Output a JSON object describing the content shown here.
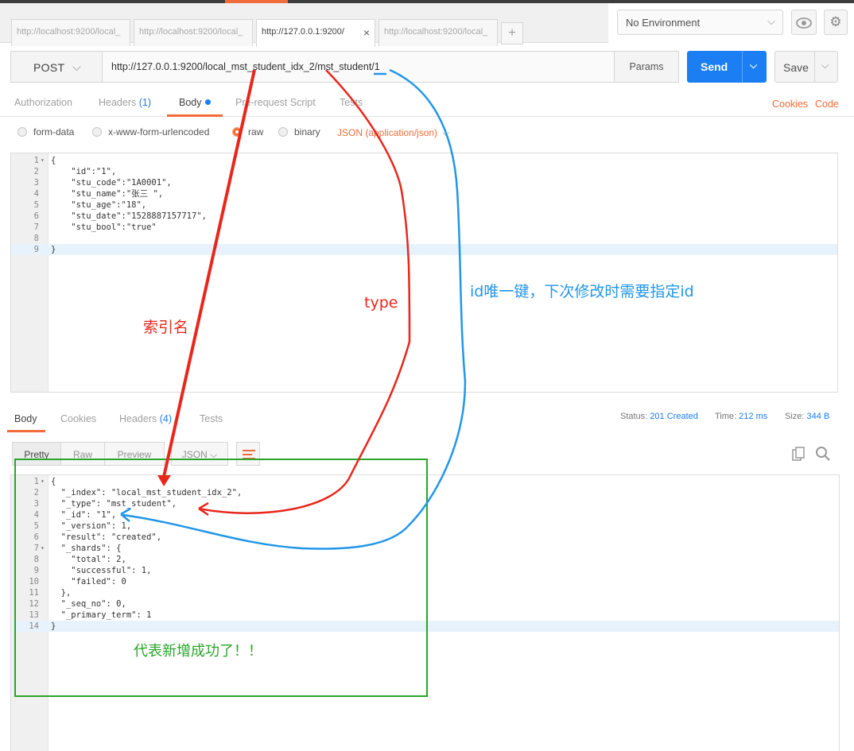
{
  "tabs": [
    {
      "label": "http://localhost:9200/local_"
    },
    {
      "label": "http://localhost:9200/local_"
    },
    {
      "label": "http://127.0.0.1:9200/"
    },
    {
      "label": "http://localhost:9200/local_"
    }
  ],
  "add_tab": "+",
  "close_tab": "×",
  "environment": {
    "selected": "No Environment"
  },
  "request": {
    "method": "POST",
    "url": "http://127.0.0.1:9200/local_mst_student_idx_2/mst_student/1",
    "params_label": "Params",
    "send_label": "Send",
    "save_label": "Save"
  },
  "request_tabs": {
    "authorization": "Authorization",
    "headers": "Headers",
    "headers_count": "(1)",
    "body": "Body",
    "prerequest": "Pre-request Script",
    "tests": "Tests",
    "cookies": "Cookies",
    "code": "Code"
  },
  "body_modes": {
    "form_data": "form-data",
    "urlencoded": "x-www-form-urlencoded",
    "raw": "raw",
    "binary": "binary",
    "content_type": "JSON (application/json)"
  },
  "request_body": [
    {
      "n": "1",
      "fold": true,
      "t": "{"
    },
    {
      "n": "2",
      "t": "    \"id\":\"1\","
    },
    {
      "n": "3",
      "t": "    \"stu_code\":\"1A0001\","
    },
    {
      "n": "4",
      "t": "    \"stu_name\":\"张三 \","
    },
    {
      "n": "5",
      "t": "    \"stu_age\":\"18\","
    },
    {
      "n": "6",
      "t": "    \"stu_date\":\"1528887157717\","
    },
    {
      "n": "7",
      "t": "    \"stu_bool\":\"true\""
    },
    {
      "n": "8",
      "t": ""
    },
    {
      "n": "9",
      "t": "}"
    }
  ],
  "response_tabs": {
    "body": "Body",
    "cookies": "Cookies",
    "headers": "Headers",
    "headers_count": "(4)",
    "tests": "Tests"
  },
  "response_status": {
    "status_label": "Status:",
    "status": "201 Created",
    "time_label": "Time:",
    "time": "212 ms",
    "size_label": "Size:",
    "size": "344 B"
  },
  "view_modes": {
    "pretty": "Pretty",
    "raw": "Raw",
    "preview": "Preview",
    "format": "JSON"
  },
  "response_body": [
    {
      "n": "1",
      "fold": true,
      "t": "{"
    },
    {
      "n": "2",
      "t": "  \"_index\": \"local_mst_student_idx_2\","
    },
    {
      "n": "3",
      "t": "  \"_type\": \"mst_student\","
    },
    {
      "n": "4",
      "t": "  \"_id\": \"1\","
    },
    {
      "n": "5",
      "t": "  \"_version\": 1,"
    },
    {
      "n": "6",
      "t": "  \"result\": \"created\","
    },
    {
      "n": "7",
      "fold": true,
      "t": "  \"_shards\": {"
    },
    {
      "n": "8",
      "t": "    \"total\": 2,"
    },
    {
      "n": "9",
      "t": "    \"successful\": 1,"
    },
    {
      "n": "10",
      "t": "    \"failed\": 0"
    },
    {
      "n": "11",
      "t": "  },"
    },
    {
      "n": "12",
      "t": "  \"_seq_no\": 0,"
    },
    {
      "n": "13",
      "t": "  \"_primary_term\": 1"
    },
    {
      "n": "14",
      "t": "}"
    }
  ],
  "annotations": {
    "index_name": "索引名",
    "type": "type",
    "id_note": "id唯一键，下次修改时需要指定id",
    "success": "代表新增成功了！！"
  },
  "colors": {
    "accent": "#f26b3a",
    "primary": "#1b7ef2",
    "annotation_red": "#e8271c",
    "annotation_blue": "#2196e8",
    "annotation_green": "#2aa52a"
  }
}
